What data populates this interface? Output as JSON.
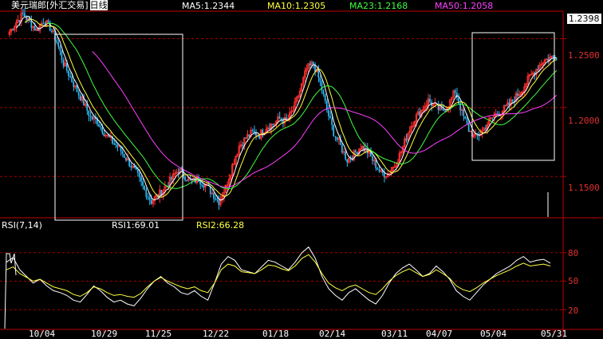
{
  "header": {
    "instrument": "美元瑞郎[外汇交易]",
    "period": "日线",
    "ma": [
      {
        "label": "MA5:1.2344",
        "color": "#ffffff"
      },
      {
        "label": "MA10:1.2305",
        "color": "#ffff40"
      },
      {
        "label": "MA23:1.2168",
        "color": "#40ff40"
      },
      {
        "label": "MA50:1.2058",
        "color": "#ff40ff"
      }
    ]
  },
  "rsi_header": {
    "name": "RSI(7,14)",
    "rsi1": "RSI1:69.01",
    "rsi2": "RSI2:66.28"
  },
  "price_axis": {
    "current": "1.2398",
    "ticks": [
      "1.2500",
      "1.2000",
      "1.1500"
    ]
  },
  "rsi_axis": {
    "ticks": [
      "80",
      "50",
      "20"
    ]
  },
  "x_ticks": [
    "10/04",
    "10/29",
    "11/25",
    "12/22",
    "01/18",
    "02/14",
    "03/11",
    "04/07",
    "05/04",
    "05/31"
  ],
  "colors": {
    "up": "#ff3030",
    "down": "#30c0ff",
    "grid": "#a00000",
    "ma5": "#ffffff",
    "ma10": "#ffff40",
    "ma23": "#40ff40",
    "ma50": "#ff40ff",
    "rsi1": "#ffffff",
    "rsi2": "#ffff40",
    "box": "#ffffff"
  },
  "chart_data": [
    {
      "type": "candlestick",
      "title": "美元瑞郎[外汇交易] 日线",
      "ylim": [
        1.12,
        1.27
      ],
      "y_ticks": [
        1.25,
        1.2,
        1.15
      ],
      "last_value": 1.2398,
      "x_tick_labels": [
        "10/04",
        "10/29",
        "11/25",
        "12/22",
        "01/18",
        "02/14",
        "03/11",
        "04/07",
        "05/04",
        "05/31"
      ],
      "close_path": [
        [
          0,
          1.255
        ],
        [
          4,
          1.262
        ],
        [
          8,
          1.268
        ],
        [
          12,
          1.262
        ],
        [
          16,
          1.256
        ],
        [
          20,
          1.263
        ],
        [
          24,
          1.258
        ],
        [
          28,
          1.248
        ],
        [
          32,
          1.232
        ],
        [
          36,
          1.222
        ],
        [
          40,
          1.212
        ],
        [
          44,
          1.203
        ],
        [
          48,
          1.193
        ],
        [
          52,
          1.19
        ],
        [
          56,
          1.182
        ],
        [
          60,
          1.176
        ],
        [
          64,
          1.172
        ],
        [
          68,
          1.165
        ],
        [
          72,
          1.158
        ],
        [
          76,
          1.15
        ],
        [
          80,
          1.14
        ],
        [
          84,
          1.132
        ],
        [
          88,
          1.136
        ],
        [
          92,
          1.142
        ],
        [
          96,
          1.148
        ],
        [
          100,
          1.155
        ],
        [
          104,
          1.15
        ],
        [
          108,
          1.146
        ],
        [
          112,
          1.148
        ],
        [
          116,
          1.144
        ],
        [
          120,
          1.138
        ],
        [
          124,
          1.132
        ],
        [
          128,
          1.142
        ],
        [
          132,
          1.158
        ],
        [
          136,
          1.172
        ],
        [
          140,
          1.178
        ],
        [
          144,
          1.182
        ],
        [
          148,
          1.18
        ],
        [
          152,
          1.186
        ],
        [
          156,
          1.188
        ],
        [
          160,
          1.192
        ],
        [
          164,
          1.19
        ],
        [
          168,
          1.198
        ],
        [
          172,
          1.212
        ],
        [
          176,
          1.228
        ],
        [
          180,
          1.232
        ],
        [
          184,
          1.218
        ],
        [
          188,
          1.198
        ],
        [
          192,
          1.182
        ],
        [
          196,
          1.172
        ],
        [
          200,
          1.162
        ],
        [
          204,
          1.166
        ],
        [
          208,
          1.172
        ],
        [
          212,
          1.168
        ],
        [
          216,
          1.16
        ],
        [
          220,
          1.152
        ],
        [
          224,
          1.152
        ],
        [
          228,
          1.158
        ],
        [
          232,
          1.168
        ],
        [
          236,
          1.182
        ],
        [
          240,
          1.192
        ],
        [
          244,
          1.198
        ],
        [
          248,
          1.205
        ],
        [
          252,
          1.201
        ],
        [
          256,
          1.197
        ],
        [
          260,
          1.202
        ],
        [
          264,
          1.212
        ],
        [
          268,
          1.196
        ],
        [
          272,
          1.184
        ],
        [
          276,
          1.178
        ],
        [
          280,
          1.183
        ],
        [
          284,
          1.19
        ],
        [
          288,
          1.195
        ],
        [
          292,
          1.198
        ],
        [
          296,
          1.202
        ],
        [
          300,
          1.208
        ],
        [
          304,
          1.214
        ],
        [
          308,
          1.222
        ],
        [
          312,
          1.228
        ],
        [
          316,
          1.234
        ],
        [
          320,
          1.236
        ],
        [
          324,
          1.238
        ]
      ],
      "overlays": [
        {
          "name": "MA5",
          "last": 1.2344
        },
        {
          "name": "MA10",
          "last": 1.2305
        },
        {
          "name": "MA23",
          "last": 1.2168
        },
        {
          "name": "MA50",
          "last": 1.2058
        }
      ]
    },
    {
      "type": "line",
      "title": "RSI(7,14)",
      "ylim": [
        0,
        100
      ],
      "y_ticks": [
        80,
        50,
        20
      ],
      "series": [
        {
          "name": "RSI1",
          "last": 69.01,
          "values": [
            70,
            75,
            62,
            55,
            48,
            52,
            45,
            40,
            38,
            35,
            30,
            28,
            36,
            45,
            40,
            33,
            28,
            30,
            26,
            24,
            32,
            42,
            50,
            55,
            48,
            44,
            38,
            36,
            40,
            34,
            30,
            48,
            68,
            76,
            72,
            62,
            60,
            58,
            65,
            72,
            70,
            66,
            62,
            70,
            80,
            86,
            74,
            55,
            42,
            35,
            30,
            38,
            42,
            36,
            30,
            26,
            35,
            48,
            58,
            64,
            68,
            62,
            55,
            58,
            66,
            60,
            52,
            40,
            34,
            30,
            38,
            46,
            52,
            58,
            62,
            66,
            72,
            76,
            70,
            72,
            73,
            69
          ]
        },
        {
          "name": "RSI2",
          "last": 66.28,
          "values": [
            62,
            65,
            58,
            54,
            50,
            52,
            48,
            44,
            42,
            40,
            36,
            34,
            38,
            44,
            42,
            38,
            35,
            36,
            34,
            33,
            37,
            44,
            50,
            54,
            50,
            47,
            44,
            42,
            44,
            40,
            38,
            48,
            62,
            68,
            66,
            60,
            59,
            58,
            62,
            67,
            66,
            63,
            61,
            66,
            74,
            78,
            70,
            58,
            48,
            43,
            40,
            44,
            46,
            42,
            38,
            36,
            42,
            50,
            56,
            60,
            63,
            59,
            55,
            57,
            62,
            58,
            53,
            45,
            41,
            39,
            43,
            48,
            52,
            56,
            59,
            62,
            66,
            69,
            66,
            67,
            68,
            66
          ]
        }
      ]
    }
  ]
}
